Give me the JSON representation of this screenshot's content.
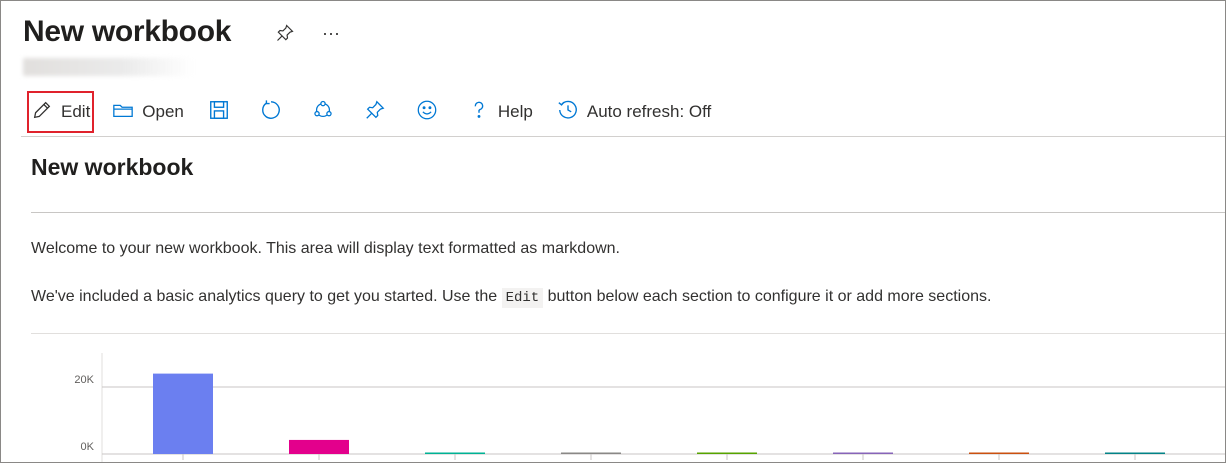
{
  "header": {
    "title": "New workbook",
    "pin_icon": "pin-icon",
    "more_icon": "more-icon",
    "more_glyph": "···"
  },
  "toolbar": {
    "edit_label": "Edit",
    "open_label": "Open",
    "save_icon": "save-icon",
    "refresh_icon": "refresh-icon",
    "share_icon": "share-icon",
    "pin_icon": "pin-icon",
    "feedback_icon": "smiley-icon",
    "help_label": "Help",
    "auto_refresh_label": "Auto refresh: Off",
    "accent_highlight": "#e0222c"
  },
  "content": {
    "title": "New workbook",
    "paragraph1": "Welcome to your new workbook. This area will display text formatted as markdown.",
    "paragraph2_before": "We've included a basic analytics query to get you started. Use the ",
    "paragraph2_code": "Edit",
    "paragraph2_after": " button below each section to configure it or add more sections."
  },
  "chart_data": {
    "type": "bar",
    "ylim": [
      0,
      30000
    ],
    "ytick_labels": [
      "20K",
      "0K"
    ],
    "yticks": [
      20000,
      0
    ],
    "categories": [
      "",
      "",
      "",
      "",
      "",
      "",
      "",
      ""
    ],
    "values": [
      24000,
      4200,
      300,
      150,
      120,
      100,
      90,
      80
    ],
    "colors": [
      "#6b7ff0",
      "#e3008c",
      "#00b294",
      "#8a8886",
      "#57a300",
      "#8764b8",
      "#ca5010",
      "#038387"
    ],
    "grid": true,
    "title": "",
    "xlabel": "",
    "ylabel": ""
  }
}
